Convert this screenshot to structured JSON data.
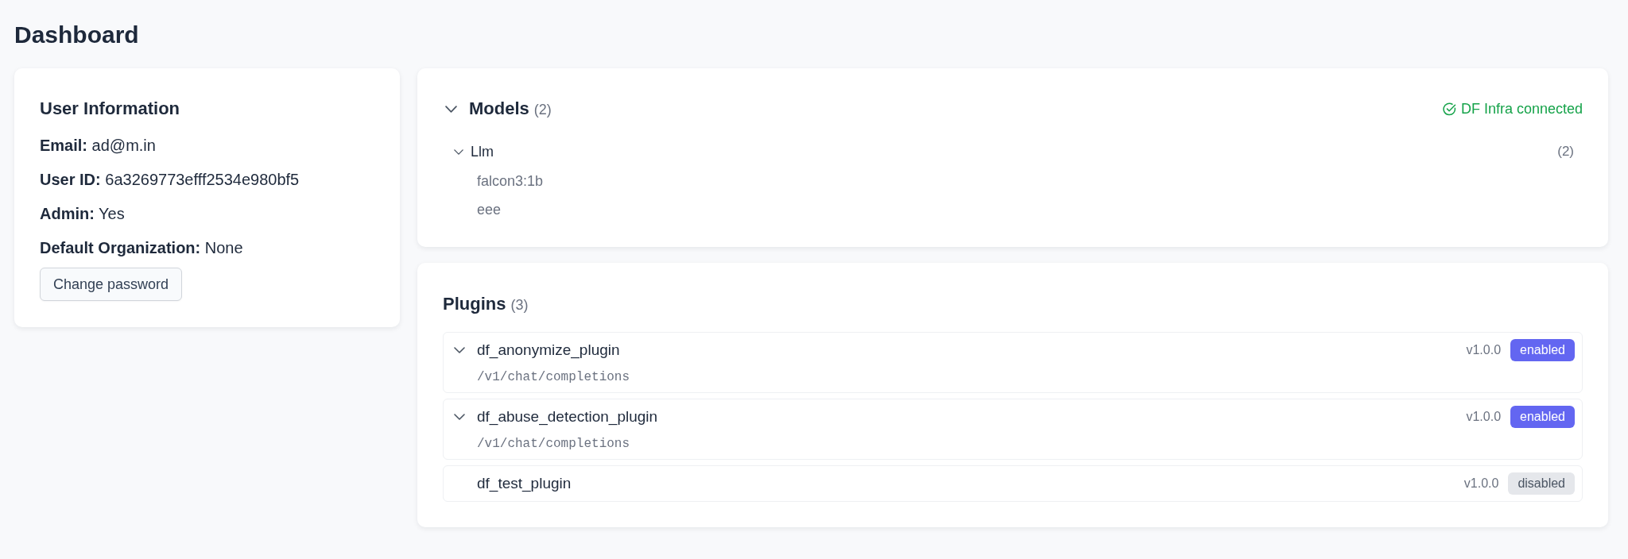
{
  "page": {
    "title": "Dashboard"
  },
  "user_information": {
    "title": "User Information",
    "fields": [
      {
        "label": "Email:",
        "value": "ad@m.in"
      },
      {
        "label": "User ID:",
        "value": "6a3269773efff2534e980bf5"
      },
      {
        "label": "Admin:",
        "value": "Yes"
      },
      {
        "label": "Default Organization:",
        "value": "None"
      }
    ],
    "button": "Change password"
  },
  "models": {
    "title": "Models",
    "count": "(2)",
    "expanded": true,
    "status": {
      "text": "DF Infra connected",
      "connected": true
    },
    "groups": [
      {
        "name": "Llm",
        "count": "(2)",
        "expanded": true,
        "items": [
          "falcon3:1b",
          "eee"
        ]
      }
    ]
  },
  "plugins": {
    "title": "Plugins",
    "count": "(3)",
    "items": [
      {
        "name": "df_anonymize_plugin",
        "expanded": true,
        "endpoints": [
          "/v1/chat/completions"
        ],
        "version": "v1.0.0",
        "status": "enabled",
        "enabled": true
      },
      {
        "name": "df_abuse_detection_plugin",
        "expanded": true,
        "endpoints": [
          "/v1/chat/completions"
        ],
        "version": "v1.0.0",
        "status": "enabled",
        "enabled": true
      },
      {
        "name": "df_test_plugin",
        "expanded": false,
        "version": "v1.0.0",
        "status": "disabled",
        "enabled": false
      }
    ]
  }
}
